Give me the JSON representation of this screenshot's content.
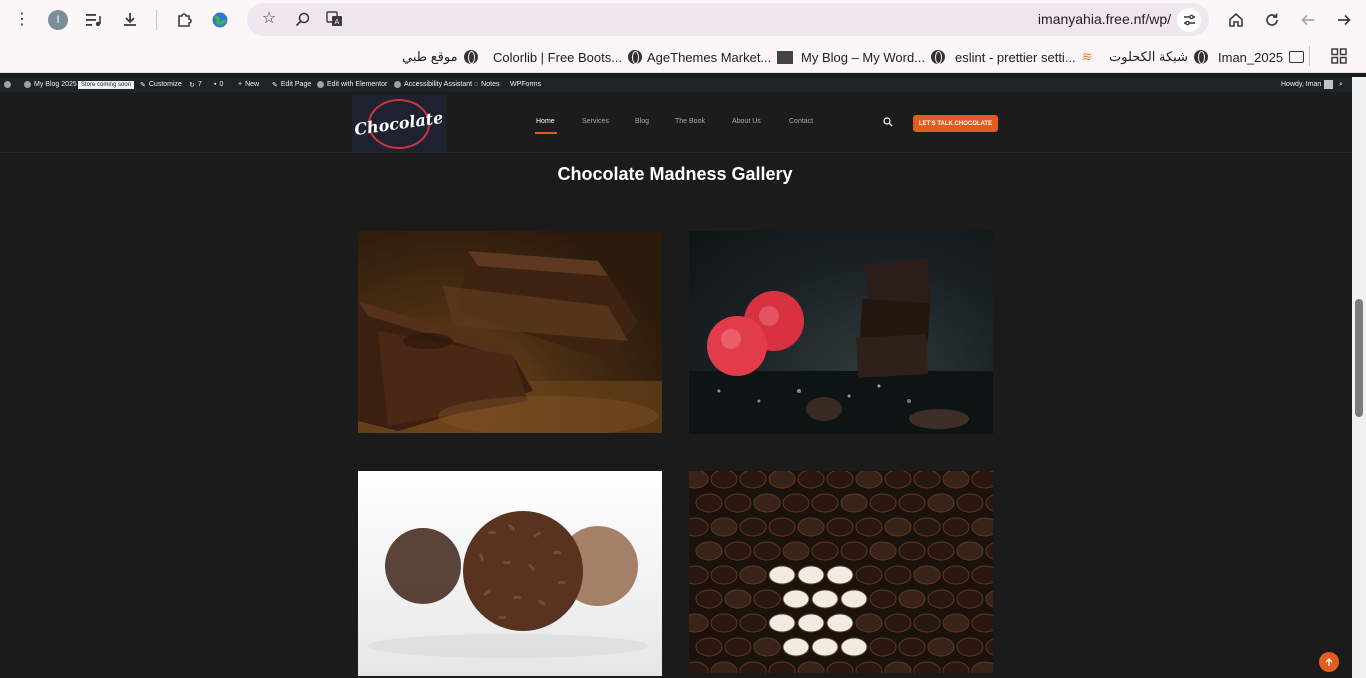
{
  "browser": {
    "profile_initial": "I",
    "url": "imanyahia.free.nf/wp/",
    "icons": {
      "menu": "more-vertical-icon",
      "reading_list": "playlist-icon",
      "downloads": "download-icon",
      "extensions": "puzzle-icon",
      "extension_globe": "globe-extension-icon",
      "bookmark_star": "star-icon",
      "lens": "search-lens-icon",
      "translate": "translate-icon",
      "site_settings": "tune-icon",
      "home": "home-icon",
      "reload": "reload-icon",
      "back": "arrow-left-icon",
      "forward": "arrow-right-icon",
      "apps": "apps-grid-icon"
    }
  },
  "bookmarks": [
    {
      "label": "موقع طبي",
      "icon": "globe-icon"
    },
    {
      "label": "Colorlib | Free Boots...",
      "icon": "globe-icon"
    },
    {
      "label": "AgeThemes Market...",
      "icon": "globe-icon"
    },
    {
      "label": "My Blog – My Word...",
      "icon": "site-thumb-icon"
    },
    {
      "label": "eslint - prettier setti...",
      "icon": "globe-icon"
    },
    {
      "label": "شبكة الكحلوت",
      "icon": "stackoverflow-icon"
    },
    {
      "label": "Iman_2025",
      "icon": "globe-icon"
    },
    {
      "label": "",
      "icon": "folder-icon"
    }
  ],
  "adminbar": {
    "site_name": "My Blog 2025",
    "badge": "Store coming soon",
    "customize": "Customize",
    "updates_count": "7",
    "comments_count": "0",
    "new": "New",
    "edit_page": "Edit Page",
    "edit_elementor": "Edit with Elementor",
    "accessibility": "Accessibility Assistant",
    "notes": "Notes",
    "wpforms": "WPForms",
    "howdy": "Howdy, Iman"
  },
  "site": {
    "logo_text": "Chocolate",
    "nav": [
      "Home",
      "Services",
      "Blog",
      "The Book",
      "About Us",
      "Contact"
    ],
    "active_nav": "Home",
    "cta": "LET'S TALK CHOCOLATE",
    "accent_color": "#e35b1e"
  },
  "content": {
    "gallery_title": "Chocolate Madness Gallery",
    "images": [
      {
        "subject": "chocolate bar pieces on cocoa powder"
      },
      {
        "subject": "raspberries and stacked dark chocolate pieces"
      },
      {
        "subject": "chocolate truffles with sprinkles"
      },
      {
        "subject": "rows of dark and white chocolate pralines"
      }
    ]
  }
}
